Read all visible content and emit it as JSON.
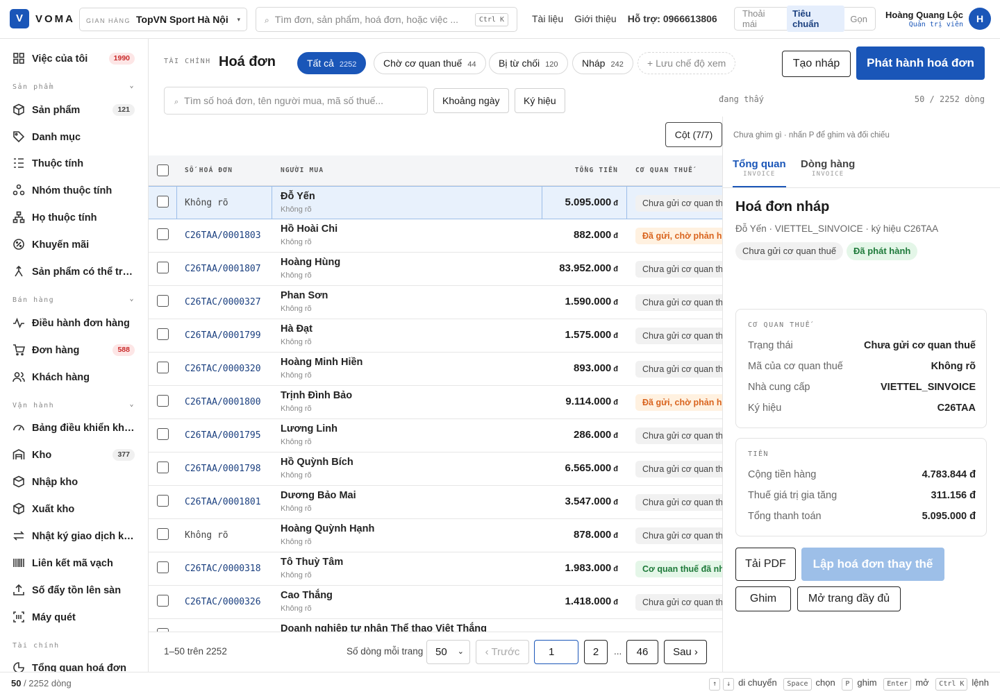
{
  "app": {
    "logo_letter": "V",
    "name": "VOMA"
  },
  "store": {
    "label": "GIAN HÀNG",
    "value": "TopVN Sport Hà Nội",
    "chevron": "▾"
  },
  "global_search": {
    "placeholder": "Tìm đơn, sản phẩm, hoá đơn, hoặc việc ...",
    "shortcut": "Ctrl K",
    "icon": "⌕"
  },
  "top_links": [
    "Tài liệu",
    "Giới thiệu",
    "Hỗ trợ: 0966613806"
  ],
  "density": [
    "Thoải mái",
    "Tiêu chuẩn",
    "Gọn"
  ],
  "user": {
    "name": "Hoàng Quang Lộc",
    "role": "Quản trị viên",
    "initial": "H"
  },
  "sidebar": {
    "top": {
      "label": "Việc của tôi",
      "badge": "1990"
    },
    "sections": [
      {
        "title": "Sản phẩm",
        "items": [
          {
            "label": "Sản phẩm",
            "badge": "121"
          },
          {
            "label": "Danh mục"
          },
          {
            "label": "Thuộc tính"
          },
          {
            "label": "Nhóm thuộc tính"
          },
          {
            "label": "Họ thuộc tính"
          },
          {
            "label": "Khuyến mãi"
          },
          {
            "label": "Sản phẩm có thể trùng lặp"
          }
        ]
      },
      {
        "title": "Bán hàng",
        "items": [
          {
            "label": "Điều hành đơn hàng"
          },
          {
            "label": "Đơn hàng",
            "badge": "588"
          },
          {
            "label": "Khách hàng"
          }
        ]
      },
      {
        "title": "Vận hành",
        "items": [
          {
            "label": "Bảng điều khiển kho hàng"
          },
          {
            "label": "Kho",
            "badge": "377"
          },
          {
            "label": "Nhập kho"
          },
          {
            "label": "Xuất kho"
          },
          {
            "label": "Nhật ký giao dịch kho"
          },
          {
            "label": "Liên kết mã vạch"
          },
          {
            "label": "Số đẩy tồn lên sàn"
          },
          {
            "label": "Máy quét"
          }
        ]
      },
      {
        "title": "Tài chính",
        "items": [
          {
            "label": "Tổng quan hoá đơn"
          }
        ]
      }
    ]
  },
  "page": {
    "crumb": "TÀI CHÍNH",
    "title": "Hoá đơn",
    "filters": [
      {
        "label": "Tất cả",
        "count": "2252"
      },
      {
        "label": "Chờ cơ quan thuế",
        "count": "44"
      },
      {
        "label": "Bị từ chối",
        "count": "120"
      },
      {
        "label": "Nháp",
        "count": "242"
      }
    ],
    "save_view": "+ Lưu chế độ xem",
    "draft_button": "Tạo nháp",
    "issue_button": "Phát hành hoá đơn",
    "search_placeholder": "Tìm số hoá đơn, tên người mua, mã số thuế...",
    "date_range": "Khoảng ngày",
    "symbol": "Ký hiệu",
    "showing": "đang thấy",
    "row_count": "50 / 2252 dòng",
    "columns_button": "Cột (7/7)",
    "pin_hint": "Chưa ghim gì · nhấn P để ghim và đối chiếu"
  },
  "table": {
    "headers": [
      "SỐ HOÁ ĐƠN",
      "NGƯỜI MUA",
      "TỔNG TIỀN",
      "CƠ QUAN THUẾ"
    ],
    "currency": "đ",
    "rows": [
      {
        "number": "Không rõ",
        "buyer": "Đỗ Yến",
        "sub": "Không rõ",
        "amount": "5.095.000",
        "status": "Chưa gửi cơ quan thuế",
        "kind": "none"
      },
      {
        "number": "C26TAA/0001803",
        "buyer": "Hồ Hoài Chi",
        "sub": "Không rõ",
        "amount": "882.000",
        "status": "Đã gửi, chờ phản hồi",
        "kind": "warn"
      },
      {
        "number": "C26TAA/0001807",
        "buyer": "Hoàng Hùng",
        "sub": "Không rõ",
        "amount": "83.952.000",
        "status": "Chưa gửi cơ quan thuế",
        "kind": "none"
      },
      {
        "number": "C26TAC/0000327",
        "buyer": "Phan Sơn",
        "sub": "Không rõ",
        "amount": "1.590.000",
        "status": "Chưa gửi cơ quan thuế",
        "kind": "none"
      },
      {
        "number": "C26TAA/0001799",
        "buyer": "Hà Đạt",
        "sub": "Không rõ",
        "amount": "1.575.000",
        "status": "Chưa gửi cơ quan thuế",
        "kind": "none"
      },
      {
        "number": "C26TAC/0000320",
        "buyer": "Hoàng Minh Hiền",
        "sub": "Không rõ",
        "amount": "893.000",
        "status": "Chưa gửi cơ quan thuế",
        "kind": "none"
      },
      {
        "number": "C26TAA/0001800",
        "buyer": "Trịnh Đình Bảo",
        "sub": "Không rõ",
        "amount": "9.114.000",
        "status": "Đã gửi, chờ phản hồi",
        "kind": "warn"
      },
      {
        "number": "C26TAA/0001795",
        "buyer": "Lương Linh",
        "sub": "Không rõ",
        "amount": "286.000",
        "status": "Chưa gửi cơ quan thuế",
        "kind": "none"
      },
      {
        "number": "C26TAA/0001798",
        "buyer": "Hồ Quỳnh Bích",
        "sub": "Không rõ",
        "amount": "6.565.000",
        "status": "Chưa gửi cơ quan thuế",
        "kind": "none"
      },
      {
        "number": "C26TAA/0001801",
        "buyer": "Dương Bảo Mai",
        "sub": "Không rõ",
        "amount": "3.547.000",
        "status": "Chưa gửi cơ quan thuế",
        "kind": "none"
      },
      {
        "number": "Không rõ",
        "buyer": "Hoàng Quỳnh Hạnh",
        "sub": "Không rõ",
        "amount": "878.000",
        "status": "Chưa gửi cơ quan thuế",
        "kind": "none"
      },
      {
        "number": "C26TAC/0000318",
        "buyer": "Tô Thuỳ Tâm",
        "sub": "Không rõ",
        "amount": "1.983.000",
        "status": "Cơ quan thuế đã nhận",
        "kind": "ok"
      },
      {
        "number": "C26TAC/0000326",
        "buyer": "Cao Thắng",
        "sub": "Không rõ",
        "amount": "1.418.000",
        "status": "Chưa gửi cơ quan thuế",
        "kind": "none"
      },
      {
        "number": "",
        "buyer": "Doanh nghiệp tư nhân Thể thao Việt Thắng",
        "sub": "",
        "amount": "",
        "status": "",
        "kind": "none"
      }
    ]
  },
  "pagination": {
    "range": "1–50 trên 2252",
    "per_page_label": "Số dòng mỗi trang",
    "per_page": "50",
    "prev": "‹ Trước",
    "current": "1",
    "page2": "2",
    "ellipsis": "...",
    "last": "46",
    "next": "Sau ›"
  },
  "panel": {
    "tabs": [
      {
        "label": "Tổng quan",
        "sub": "INVOICE"
      },
      {
        "label": "Dòng hàng",
        "sub": "INVOICE"
      }
    ],
    "title": "Hoá đơn nháp",
    "subtitle": "Đỗ Yến · VIETTEL_SINVOICE · ký hiệu C26TAA",
    "tags": [
      "Chưa gửi cơ quan thuế",
      "Đã phát hành"
    ],
    "tax_card": {
      "title": "CƠ QUAN THUẾ",
      "rows": [
        {
          "k": "Trạng thái",
          "v": "Chưa gửi cơ quan thuế"
        },
        {
          "k": "Mã của cơ quan thuế",
          "v": "Không rõ"
        },
        {
          "k": "Nhà cung cấp",
          "v": "VIETTEL_SINVOICE"
        },
        {
          "k": "Ký hiệu",
          "v": "C26TAA"
        }
      ]
    },
    "money_card": {
      "title": "TIỀN",
      "rows": [
        {
          "k": "Cộng tiền hàng",
          "v": "4.783.844 đ"
        },
        {
          "k": "Thuế giá trị gia tăng",
          "v": "311.156 đ"
        },
        {
          "k": "Tổng thanh toán",
          "v": "5.095.000 đ"
        }
      ]
    },
    "buttons": {
      "pdf": "Tải PDF",
      "replace": "Lập hoá đơn thay thế",
      "pin": "Ghim",
      "open": "Mở trang đầy đủ"
    }
  },
  "footer": {
    "count": "50",
    "count_rest": " / 2252 dòng",
    "hints": [
      {
        "keys": [
          "↑",
          "↓"
        ],
        "text": "di chuyển"
      },
      {
        "keys": [
          "Space"
        ],
        "text": "chọn"
      },
      {
        "keys": [
          "P"
        ],
        "text": "ghim"
      },
      {
        "keys": [
          "Enter"
        ],
        "text": "mở"
      },
      {
        "keys": [
          "Ctrl K"
        ],
        "text": "lệnh"
      }
    ]
  },
  "colors": {
    "accent": "#1a56b8",
    "danger": "#c92a2a",
    "warn": "#d9641e",
    "ok": "#1e7a3a"
  }
}
